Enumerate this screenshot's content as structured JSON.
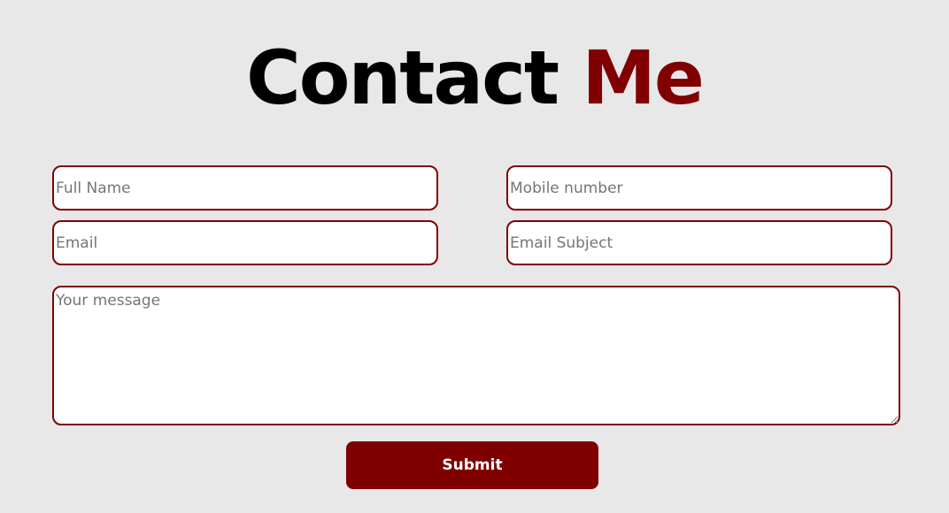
{
  "header": {
    "title_main": "Contact",
    "title_accent": "Me"
  },
  "form": {
    "full_name": {
      "placeholder": "Full Name",
      "value": ""
    },
    "mobile": {
      "placeholder": "Mobile number",
      "value": ""
    },
    "email": {
      "placeholder": "Email",
      "value": ""
    },
    "subject": {
      "placeholder": "Email Subject",
      "value": ""
    },
    "message": {
      "placeholder": "Your message",
      "value": ""
    },
    "submit_label": "Submit"
  },
  "colors": {
    "accent": "#800000",
    "background": "#e8e8e8",
    "field_background": "#ffffff",
    "button_text": "#ffffff"
  }
}
